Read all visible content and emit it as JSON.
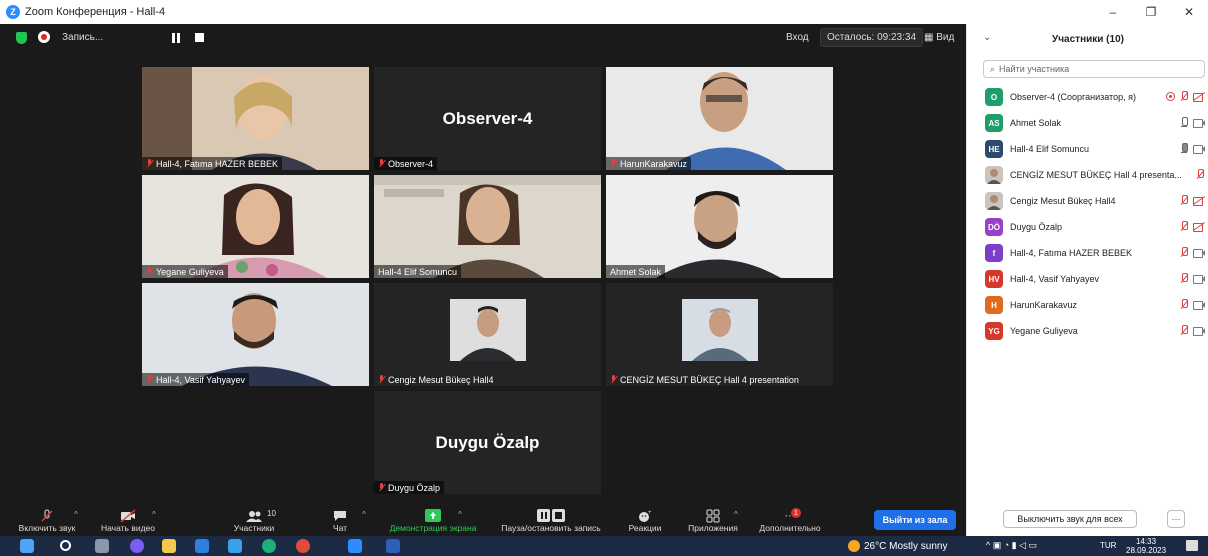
{
  "window": {
    "title": "Zoom Конференция - Hall-4",
    "minimize": "–",
    "maximize": "❐",
    "close": "✕"
  },
  "topbar": {
    "recording_label": "Запись...",
    "entry_label": "Вход",
    "remaining_label": "Осталось: 09:23:34",
    "view_label": "Вид"
  },
  "tiles": [
    {
      "name": "Hall-4, Fatıma HAZER BEBEK",
      "type": "video",
      "muted": true
    },
    {
      "name": "Observer-4",
      "type": "name",
      "center": "Observer-4",
      "muted": true
    },
    {
      "name": "HarunKarakavuz",
      "type": "video",
      "muted": true
    },
    {
      "name": "Yegane Guliyeva",
      "type": "video",
      "muted": true
    },
    {
      "name": "Hall-4 Elif Somuncu",
      "type": "video",
      "muted": false,
      "active": true
    },
    {
      "name": "Ahmet Solak",
      "type": "video",
      "muted": false
    },
    {
      "name": "Hall-4, Vasif Yahyayev",
      "type": "video",
      "muted": true
    },
    {
      "name": "Cengiz Mesut Bükeç Hall4",
      "type": "thumb",
      "muted": true
    },
    {
      "name": "CENGİZ MESUT BÜKEÇ Hall 4 presentation",
      "type": "thumb",
      "muted": true
    },
    {
      "name": "Duygu Özalp",
      "type": "name",
      "center": "Duygu Özalp",
      "muted": true
    }
  ],
  "toolbar": {
    "unmute": "Включить звук",
    "start_video": "Начать видео",
    "participants": "Участники",
    "participants_count": "10",
    "chat": "Чат",
    "share_screen": "Демонстрация экрана",
    "pause_record": "Пауза/остановить запись",
    "reactions": "Реакции",
    "apps": "Приложения",
    "more": "Дополнительно",
    "more_badge": "1",
    "leave": "Выйти из зала"
  },
  "panel": {
    "title": "Участники (10)",
    "search_placeholder": "Найти участника",
    "participants": [
      {
        "initials": "O",
        "color": "#1e9e6a",
        "name": "Observer-4 (Соорганизатор, я)",
        "rec": true,
        "mic": "off",
        "cam": "off"
      },
      {
        "initials": "AS",
        "color": "#1e9e6a",
        "name": "Ahmet Solak",
        "mic": "on",
        "cam": "on"
      },
      {
        "initials": "HE",
        "color": "#2d4a6e",
        "name": "Hall-4 Elif Somuncu",
        "mic": "talk",
        "cam": "on"
      },
      {
        "initials": "",
        "color": "#c9c4bd",
        "name": "CENGİZ MESUT BÜKEÇ Hall 4 presenta...",
        "mic": "off",
        "cam": "none"
      },
      {
        "initials": "",
        "color": "#c9c4bd",
        "name": "Cengiz Mesut Bükeç Hall4",
        "mic": "off",
        "cam": "off"
      },
      {
        "initials": "DÖ",
        "color": "#9a3fc9",
        "name": "Duygu Özalp",
        "mic": "off",
        "cam": "off"
      },
      {
        "initials": "f",
        "color": "#7b3fc9",
        "name": "Hall-4, Fatıma HAZER BEBEK",
        "mic": "off",
        "cam": "on"
      },
      {
        "initials": "HV",
        "color": "#d6392c",
        "name": "Hall-4, Vasif Yahyayev",
        "mic": "off",
        "cam": "on"
      },
      {
        "initials": "H",
        "color": "#e06a1e",
        "name": "HarunKarakavuz",
        "mic": "off",
        "cam": "on"
      },
      {
        "initials": "YG",
        "color": "#d6392c",
        "name": "Yegane Guliyeva",
        "mic": "off",
        "cam": "on"
      }
    ],
    "mute_all": "Выключить звук для всех",
    "more": "···"
  },
  "taskbar": {
    "weather": "26°C  Mostly sunny",
    "lang": "TUR",
    "time": "14:33",
    "date": "28.09.2023"
  },
  "colors": {
    "accent": "#1e6fe8",
    "active_speaker": "#b7d93a",
    "muted": "#e04040",
    "share_green": "#30c85a"
  }
}
